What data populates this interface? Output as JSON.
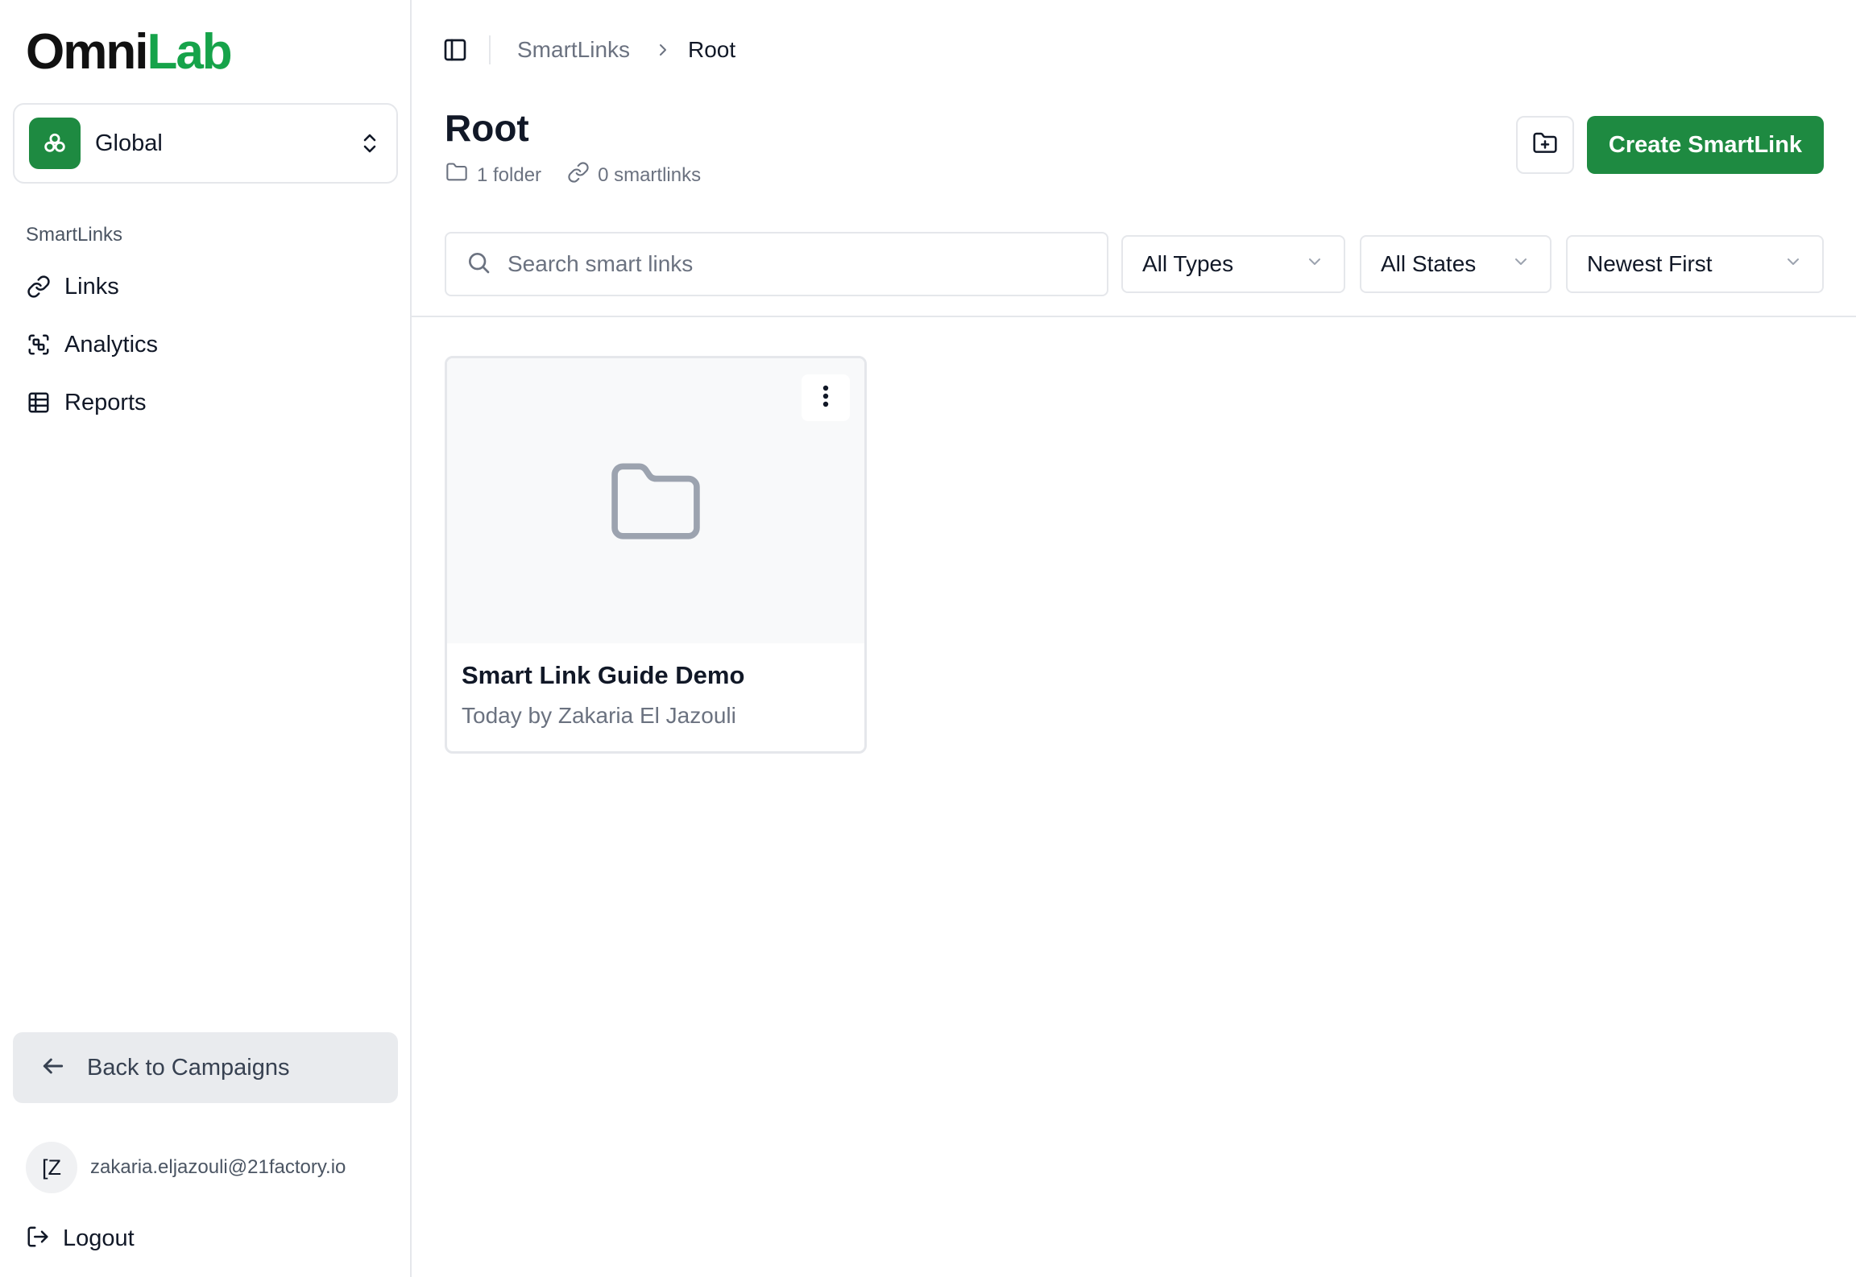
{
  "brand": {
    "part1": "Omni",
    "part2": "Lab",
    "accent": "#16a34a"
  },
  "workspace": {
    "name": "Global",
    "icon": "workspace-icon",
    "color": "#1e8a41"
  },
  "sidebar": {
    "section_label": "SmartLinks",
    "items": [
      {
        "label": "Links",
        "icon": "link-icon"
      },
      {
        "label": "Analytics",
        "icon": "analytics-icon"
      },
      {
        "label": "Reports",
        "icon": "table-icon"
      }
    ],
    "back_label": "Back to Campaigns",
    "user": {
      "initials": "[Z",
      "email": "zakaria.eljazouli@21factory.io"
    },
    "logout_label": "Logout"
  },
  "breadcrumb": {
    "items": [
      "SmartLinks",
      "Root"
    ]
  },
  "header": {
    "title": "Root",
    "folder_count": "1 folder",
    "link_count": "0 smartlinks",
    "create_label": "Create SmartLink"
  },
  "filters": {
    "search_placeholder": "Search smart links",
    "type": "All Types",
    "state": "All States",
    "sort": "Newest First"
  },
  "items": [
    {
      "name": "Smart Link Guide Demo",
      "meta": "Today by Zakaria El Jazouli"
    }
  ]
}
